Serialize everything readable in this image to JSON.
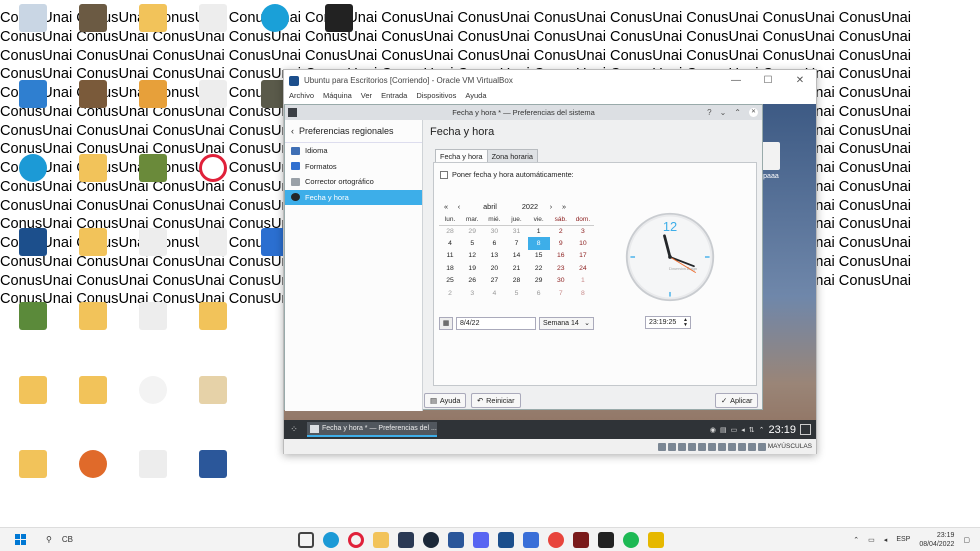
{
  "wallpaper_text": "ConusUnai ConusUnai ConusUnai ConusUnai ConusUnai ConusUnai ConusUnai ConusUnai ConusUnai ConusUnai ConusUnai ConusUnai ConusUnai ConusUnai ConusUnai ConusUnai ConusUnai ConusUnai ConusUnai ConusUnai ConusUnai ConusUnai ConusUnai ConusUnai ConusUnai ConusUnai ConusUnai ConusUnai ConusUnai ConusUnai ConusUnai ConusUnai ConusUnai ConusUnai ConusUnai ConusUnai ConusUnai ConusUnai ConusUnai ConusUnai ConusUnai ConusUnai ConusUnai ConusUnai ConusUnai ConusUnai ConusUnai ConusUnai ConusUnai ConusUnai ConusUnai ConusUnai ConusUnai ConusUnai ConusUnai ConusUnai ConusUnai ConusUnai ConusUnai ConusUnai ConusUnai ConusUnai ConusUnai ConusUnai ConusUnai ConusUnai ConusUnai ConusUnai ConusUnai ConusUnai ConusUnai ConusUnai ConusUnai ConusUnai ConusUnai ConusUnai ConusUnai ConusUnai ConusUnai ConusUnai ConusUnai ConusUnai ConusUnai ConusUnai ConusUnai ConusUnai ConusUnai ConusUnai ConusUnai ConusUnai ConusUnai ConusUnai ConusUnai ConusUnai ConusUnai ConusUnai ConusUnai ConusUnai ConusUnai ConusUnai ConusUnai ConusUnai ConusUnai ConusUnai ConusUnai ConusUnai ConusUnai ConusUnai ConusUnai ConusUnai ConusUnai ConusUnai ConusUnai ConusUnai ConusUnai ConusUnai ConusUnai ConusUnai ConusUnai ConusUnai ConusUnai ConusUnai ConusUnai ConusUnai ConusUnai ConusUnai ConusUnai ConusUnai ConusUnai ConusUnai ConusUnai ConusUnai ConusUnai ConusUnai ConusUnai ConusUnai ConusUnai ConusUnai ConusUnai ConusUnai ConusUnai ConusUnai ConusUnai ConusUnai ConusUnai ConusUnai ConusUnai ConusUnai ConusUnai ConusUnai ConusUnai ConusUnai ConusUnai ConusUnai ConusUnai ConusUnai ConusUnai ConusUnai ConusUnai ConusUnai ConusUnai ConusUnai ConusUnai ConusUnai ConusUnai ConusUnai ConusUnai ConusUnai ConusUnai ConusUnai ConusUnai ConusUnai ConusUnai ConusUnai ConusUnai ConusUnai ConusUnai ConusUnai ConusUnai ConusUnai ConusUnai ConusUnai ConusUnai ConusUnai Conus",
  "virtualbox": {
    "title": "Ubuntu para Escritorios [Corriendo] - Oracle VM VirtualBox",
    "menu": [
      "Archivo",
      "Máquina",
      "Ver",
      "Entrada",
      "Dispositivos",
      "Ayuda"
    ],
    "guest_desktop_file": "epaaa"
  },
  "dialog": {
    "title": "Fecha y hora * — Preferencias del sistema",
    "title_help": "?",
    "sidebar_header": "Preferencias regionales",
    "sidebar_items": [
      {
        "label": "Idioma",
        "icon": "flag-icon",
        "color": "#3f6fb5"
      },
      {
        "label": "Formatos",
        "icon": "formats-icon",
        "color": "#2f6fd0"
      },
      {
        "label": "Corrector ortográfico",
        "icon": "spellcheck-icon",
        "color": "#9aa1a8"
      },
      {
        "label": "Fecha y hora",
        "icon": "clock-icon",
        "color": "#232629"
      }
    ],
    "page_title": "Fecha y hora",
    "tabs": [
      "Fecha y hora",
      "Zona horaria"
    ],
    "auto_label": "Poner fecha y hora automáticamente:",
    "calendar": {
      "month": "abril",
      "year": "2022",
      "weekdays": [
        "lun.",
        "mar.",
        "mié.",
        "jue.",
        "vie.",
        "sáb.",
        "dom."
      ],
      "weeks": [
        [
          "28",
          "29",
          "30",
          "31",
          "1",
          "2",
          "3"
        ],
        [
          "4",
          "5",
          "6",
          "7",
          "8",
          "9",
          "10"
        ],
        [
          "11",
          "12",
          "13",
          "14",
          "15",
          "16",
          "17"
        ],
        [
          "18",
          "19",
          "20",
          "21",
          "22",
          "23",
          "24"
        ],
        [
          "25",
          "26",
          "27",
          "28",
          "29",
          "30",
          "1"
        ],
        [
          "2",
          "3",
          "4",
          "5",
          "6",
          "7",
          "8"
        ]
      ],
      "selected": "8"
    },
    "date_value": "8/4/22",
    "week_value": "Semana 14",
    "time_value": "23:19:25",
    "clock_twelve": "12",
    "clock_brand": "Conversion Design",
    "buttons": {
      "help": "Ayuda",
      "reset": "Reiniciar",
      "apply": "Aplicar"
    }
  },
  "guest_taskbar": {
    "task_label": "Fecha y hora * — Preferencias del ...",
    "clock": "23:19"
  },
  "vbox_status": {
    "keyboard": "MAYÚSCULAS"
  },
  "taskbar": {
    "search": "CB",
    "lang": "ESP",
    "time": "23:19",
    "date": "08/04/2022"
  }
}
